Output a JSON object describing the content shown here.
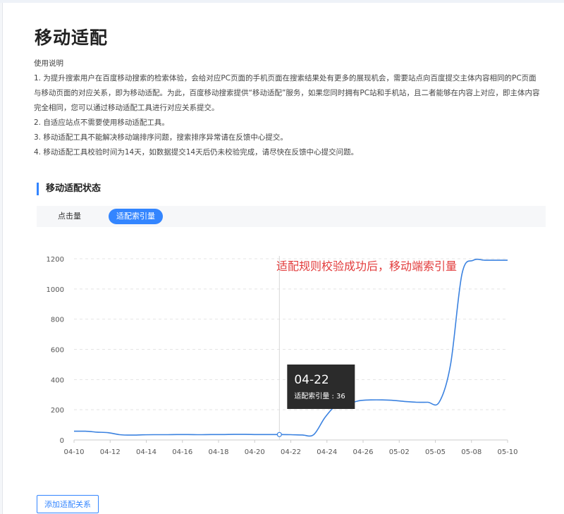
{
  "page": {
    "title": "移动适配"
  },
  "usage": {
    "heading": "使用说明",
    "lines": [
      "1. 为提升搜索用户在百度移动搜索的检索体验，会给对应PC页面的手机页面在搜索结果处有更多的展现机会，需要站点向百度提交主体内容相同的PC页面",
      "与移动页面的对应关系，即为移动适配。为此，百度移动搜索提供“移动适配”服务，如果您同时拥有PC站和手机站，且二者能够在内容上对应，即主体内容",
      "完全相同，您可以通过移动适配工具进行对应关系提交。",
      "2. 自适应站点不需要使用移动适配工具。",
      "3. 移动适配工具不能解决移动端排序问题，搜索排序异常请在反馈中心提交。",
      "4. 移动适配工具校验时间为14天，如数据提交14天后仍未校验完成，请尽快在反馈中心提交问题。"
    ]
  },
  "section": {
    "title": "移动适配状态"
  },
  "tabs": [
    {
      "label": "点击量",
      "active": false
    },
    {
      "label": "适配索引量",
      "active": true
    }
  ],
  "colors": {
    "accent": "#3385ff",
    "line": "#3b82e0",
    "annotation": "#e23b3b",
    "tooltip_bg": "#2b2b2b"
  },
  "chart_data": {
    "type": "line",
    "x_tick_labels": [
      "04-10",
      "04-12",
      "04-14",
      "04-16",
      "04-18",
      "04-20",
      "04-22",
      "04-24",
      "04-26",
      "05-02",
      "05-05",
      "05-08",
      "05-10"
    ],
    "ylim": [
      0,
      1200
    ],
    "yticks": [
      0,
      200,
      400,
      600,
      800,
      1000,
      1200
    ],
    "grid": true,
    "series": [
      {
        "values": [
          58,
          58,
          52,
          48,
          35,
          32,
          34,
          35,
          35,
          36,
          36,
          35,
          36,
          36,
          37,
          37,
          36,
          36,
          36,
          35,
          33,
          35,
          150,
          230,
          240,
          260,
          265,
          265,
          262,
          255,
          250,
          250,
          250,
          500,
          1100,
          1190,
          1190,
          1190,
          1190
        ]
      }
    ],
    "annotation": "适配规则校验成功后，移动端索引量",
    "tooltip": {
      "date": "04-22",
      "label": "适配索引量",
      "value": 36,
      "index": 18
    }
  },
  "actions": {
    "add_label": "添加适配关系"
  }
}
